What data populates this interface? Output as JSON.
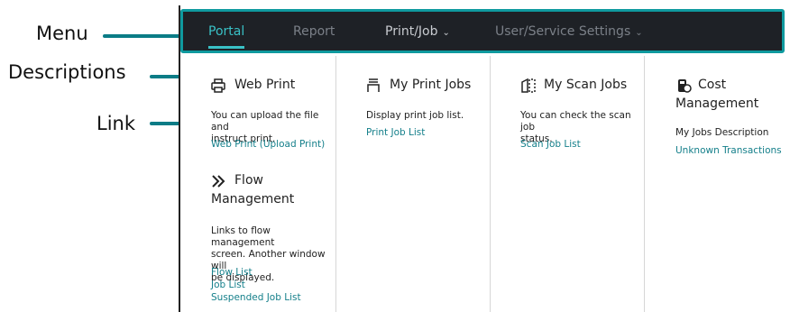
{
  "callouts": {
    "menu": "Menu",
    "descriptions": "Descriptions",
    "link": "Link"
  },
  "menu": {
    "items": [
      {
        "label": "Portal",
        "active": true
      },
      {
        "label": "Report"
      },
      {
        "label": "Print/Job",
        "dropdown": true
      },
      {
        "label": "User/Service Settings",
        "dropdown": true
      }
    ],
    "chevron": "⌄"
  },
  "columns": {
    "web_print": {
      "title": "Web Print",
      "icon": "printer-icon",
      "description": [
        "You can upload the file and",
        "instruct print."
      ],
      "links": [
        "Web Print (Upload Print)"
      ]
    },
    "flow": {
      "title": [
        "Flow",
        "Management"
      ],
      "icon": "double-chevron-icon",
      "description": [
        "Links to flow management",
        "screen. Another window will",
        "be displayed."
      ],
      "links": [
        "Flow List",
        "Job List",
        "Suspended Job List"
      ]
    },
    "my_print_jobs": {
      "title": "My Print Jobs",
      "icon": "print-jobs-icon",
      "description": [
        "Display print job list."
      ],
      "links": [
        "Print Job List"
      ]
    },
    "my_scan_jobs": {
      "title": "My Scan Jobs",
      "icon": "scan-jobs-icon",
      "description": [
        "You can check the scan job",
        "status."
      ],
      "links": [
        "Scan Job List"
      ]
    },
    "cost": {
      "title": [
        "Cost",
        "Management"
      ],
      "icon": "cost-icon",
      "description": [
        "My Jobs Description"
      ],
      "links": [
        "Unknown Transactions"
      ]
    }
  },
  "colors": {
    "menubar": "#1e2126",
    "accent": "#39c1c6",
    "callout_line": "#0b7c86",
    "link": "#147f8a"
  }
}
